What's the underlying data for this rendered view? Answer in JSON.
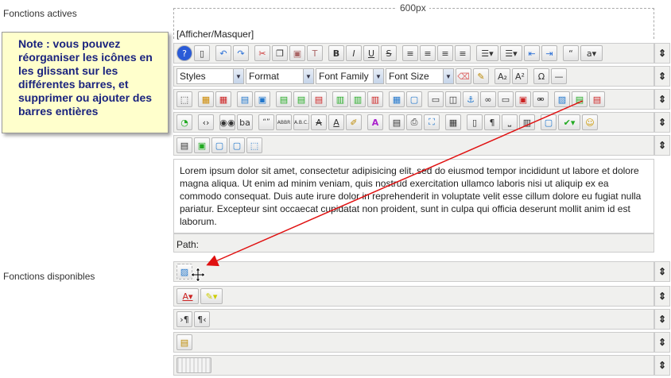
{
  "labels": {
    "active": "Fonctions actives",
    "available": "Fonctions disponibles"
  },
  "ruler": {
    "width_text": "600px"
  },
  "toggle": "[Afficher/Masquer]",
  "note": "Note : vous pouvez réorganiser les icônes en les glissant sur les différentes barres, et supprimer ou ajouter des barres entières",
  "selects": {
    "styles": "Styles",
    "format": "Format",
    "font_family": "Font Family",
    "font_size": "Font Size"
  },
  "editor_text": "Lorem ipsum dolor sit amet, consectetur adipisicing elit, sed do eiusmod tempor incididunt ut labore et dolore magna aliqua. Ut enim ad minim veniam, quis nostrud exercitation ullamco laboris nisi ut aliquip ex ea commodo consequat. Duis aute irure dolor in reprehenderit in voluptate velit esse cillum dolore eu fugiat nulla pariatur. Excepteur sint occaecat cupidatat non proident, sunt in culpa qui officia deserunt mollit anim id est laborum.",
  "path_label": "Path:",
  "handle_glyph": "⇕",
  "glyphs": {
    "bold": "B",
    "italic": "I",
    "underline": "U",
    "strike": "S",
    "abbr": "ABBR",
    "acronym": "A.B.C.",
    "omega": "Ω",
    "pilcrow": "¶"
  },
  "colors": {
    "arrow": "#e01010",
    "note_text": "#1a237e",
    "note_bg": "#ffffcc"
  }
}
